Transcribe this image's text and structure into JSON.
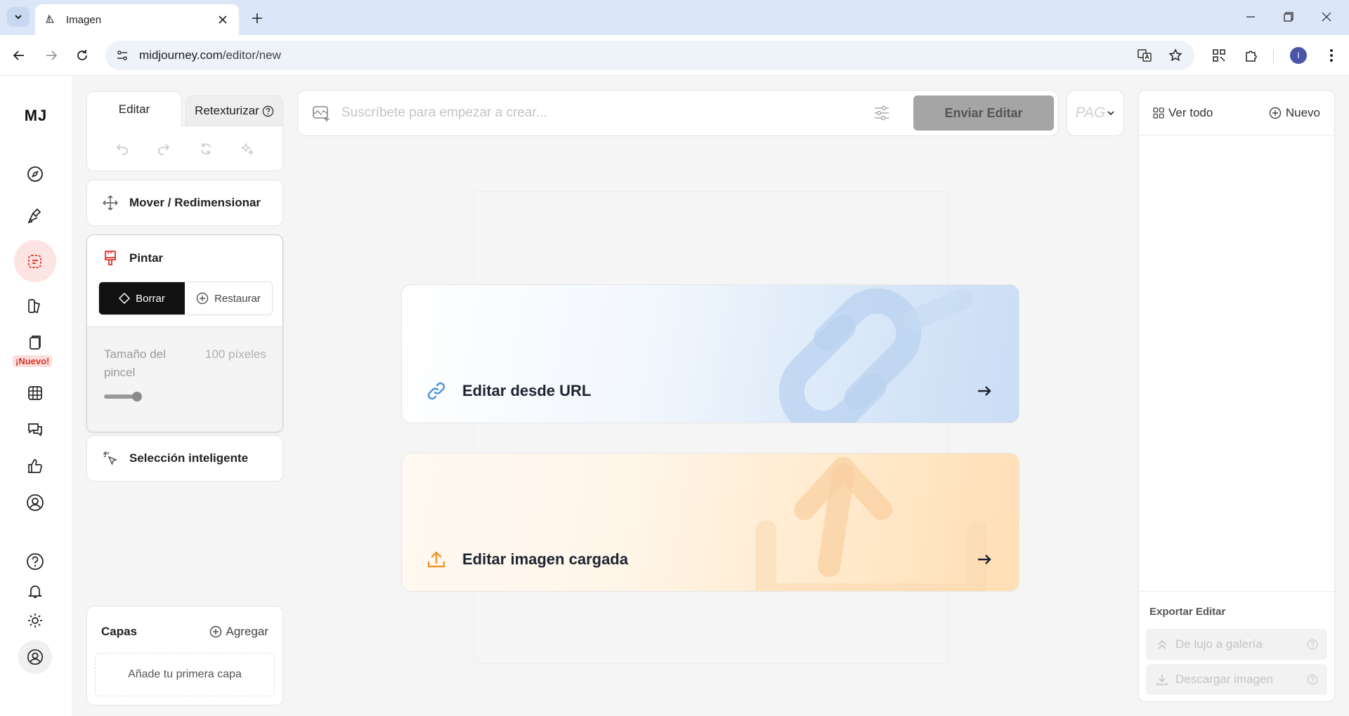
{
  "browser": {
    "tab_title": "Imagen",
    "url_host": "midjourney.com",
    "url_path": "/editor/new",
    "profile_initial": "I"
  },
  "nav": {
    "logo": "MJ",
    "new_badge": "¡Nuevo!",
    "active_item": "edit"
  },
  "tools": {
    "tab_edit": "Editar",
    "tab_retexture": "Retexturizar",
    "move_resize": "Mover / Redimensionar",
    "paint": "Pintar",
    "erase": "Borrar",
    "restore": "Restaurar",
    "brush_size_label": "Tamaño del pincel",
    "brush_size_value": "100 píxeles",
    "brush_size_level": 0.25,
    "smart_select": "Selección inteligente",
    "layers_title": "Capas",
    "layers_add": "Agregar",
    "layers_empty": "Añade tu primera capa"
  },
  "prompt": {
    "placeholder": "Suscríbete para empezar a crear...",
    "submit": "Enviar Editar",
    "pag": "PAG"
  },
  "canvas": {
    "edit_from_url": "Editar desde URL",
    "edit_uploaded": "Editar imagen cargada"
  },
  "right_panel": {
    "view_all": "Ver todo",
    "new": "Nuevo",
    "export_title": "Exportar Editar",
    "to_gallery": "De lujo a galería",
    "download": "Descargar imagen"
  },
  "colors": {
    "accent_red": "#e0433a",
    "url_blue": "#4a8fd6",
    "upload_orange": "#f0962a"
  }
}
